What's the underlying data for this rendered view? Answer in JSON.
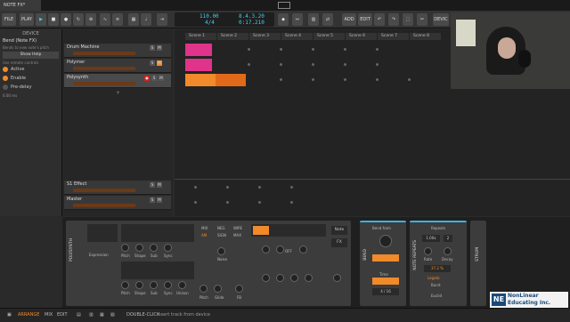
{
  "tab": {
    "title": "NOTE FX*"
  },
  "toolbar": {
    "file": "FILE",
    "play": "PLAY",
    "tempo": "110.00",
    "signature": "4/4",
    "position": "8.4.3.20",
    "time": "0:17.210",
    "add": "ADD",
    "edit": "EDIT",
    "device": "DEVIC"
  },
  "device_panel": {
    "title": "DEVICE",
    "device_name": "Bend (Note FX)",
    "subtitle": "Bends to new note's pitch",
    "show_help": "Show Help",
    "remote_controls": "Use remote controls",
    "active": "Active",
    "enable": "Enable",
    "pre_delay": "Pre-delay",
    "delay_value": "0.00 ms"
  },
  "tracks": [
    {
      "name": "Drum Machine",
      "color": "#e0338a"
    },
    {
      "name": "Polymer",
      "color": "#e0338a"
    },
    {
      "name": "Polysynth",
      "color": "#f08a2a"
    }
  ],
  "bottom_tracks": [
    {
      "name": "S1 Effect"
    },
    {
      "name": "Master"
    }
  ],
  "scenes": [
    "Scene 1",
    "Scene 2",
    "Scene 3",
    "Scene 4",
    "Scene 5",
    "Scene 6",
    "Scene 7",
    "Scene 8"
  ],
  "devices": {
    "polysynth": "POLYSYNTH",
    "labels1": [
      "Pitch",
      "Shape",
      "Sub",
      "Sync",
      "Noise"
    ],
    "labels2": [
      "Pitch",
      "Shape",
      "Sub",
      "Sync",
      "Unison"
    ],
    "labels3": [
      "Pitch",
      "Glide",
      "FB"
    ],
    "mix_tabs": [
      "MIX",
      "NEG",
      "WIPE",
      "AM",
      "SIGN",
      "MAX"
    ],
    "off": "OFF",
    "expression": "Expression",
    "bend": "BEND",
    "bend_from": "Bend from",
    "bend_time": "Time",
    "bend_time_val": "4 / 16",
    "note_repeats": "NOTE REPEATS",
    "repeats": "Repeats",
    "rate": "Rate",
    "decay": "Decay",
    "legato": "Legato",
    "burst": "Burst",
    "euclid": "Euclid",
    "rate_val": "1.00x",
    "count": "2",
    "value1": "37.2 %",
    "strum": "STRUM",
    "note": "Note",
    "fx": "FX"
  },
  "status": {
    "arrange": "ARRANGE",
    "mix": "MIX",
    "edit": "EDIT",
    "hint_action": "DOUBLE-CLICK",
    "hint_text": "Insert track from device"
  },
  "logo": {
    "mark": "NE",
    "line1": "NonLinear",
    "line2": "Educating Inc."
  }
}
